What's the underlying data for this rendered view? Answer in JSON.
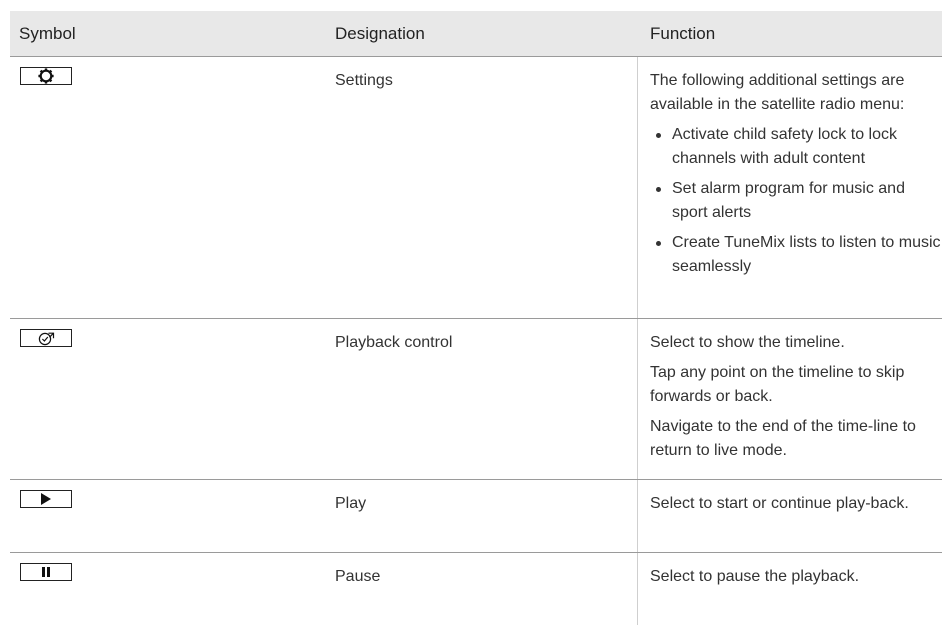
{
  "table": {
    "headers": {
      "symbol": "Symbol",
      "designation": "Designation",
      "function": "Function"
    },
    "rows": [
      {
        "icon": "gear-icon",
        "designation": "Settings",
        "function_intro": "The following additional settings are available in the satellite radio menu:",
        "bullets": [
          "Activate child safety lock to lock channels with adult content",
          "Set alarm program for music and sport alerts",
          "Create TuneMix lists to listen to music seamlessly"
        ]
      },
      {
        "icon": "playback-control-icon",
        "designation": "Playback control",
        "function_lines": [
          "Select to show the timeline.",
          "Tap any point on the timeline to skip forwards or back.",
          "Navigate to the end of the time-line to return to live mode."
        ]
      },
      {
        "icon": "play-icon",
        "designation": "Play",
        "function_lines": [
          "Select to start or continue play-back."
        ]
      },
      {
        "icon": "pause-icon",
        "designation": "Pause",
        "function_lines": [
          "Select to pause the playback."
        ]
      }
    ]
  }
}
